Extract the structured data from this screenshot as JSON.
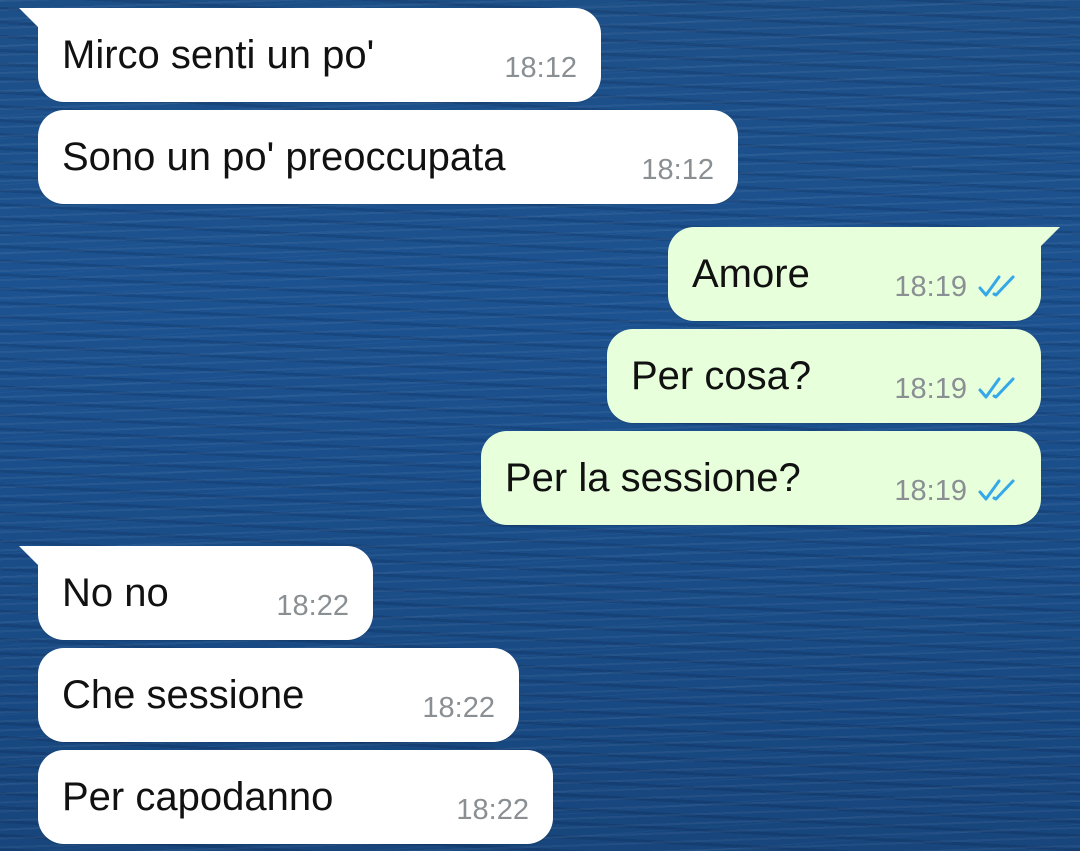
{
  "colors": {
    "incoming_bubble": "#ffffff",
    "outgoing_bubble": "#e7ffdb",
    "read_ticks": "#34a8e8",
    "timestamp": "#8a8f93",
    "wallpaper": "#1c5290"
  },
  "messages": [
    {
      "direction": "incoming",
      "text": "Mirco senti un po'",
      "time": "18:12"
    },
    {
      "direction": "incoming",
      "text": "Sono un po' preoccupata",
      "time": "18:12"
    },
    {
      "direction": "outgoing",
      "text": "Amore",
      "time": "18:19",
      "status": "read-double-check-icon"
    },
    {
      "direction": "outgoing",
      "text": "Per cosa?",
      "time": "18:19",
      "status": "read-double-check-icon"
    },
    {
      "direction": "outgoing",
      "text": "Per la sessione?",
      "time": "18:19",
      "status": "read-double-check-icon"
    },
    {
      "direction": "incoming",
      "text": "No no",
      "time": "18:22"
    },
    {
      "direction": "incoming",
      "text": "Che sessione",
      "time": "18:22"
    },
    {
      "direction": "incoming",
      "text": "Per capodanno",
      "time": "18:22"
    }
  ]
}
